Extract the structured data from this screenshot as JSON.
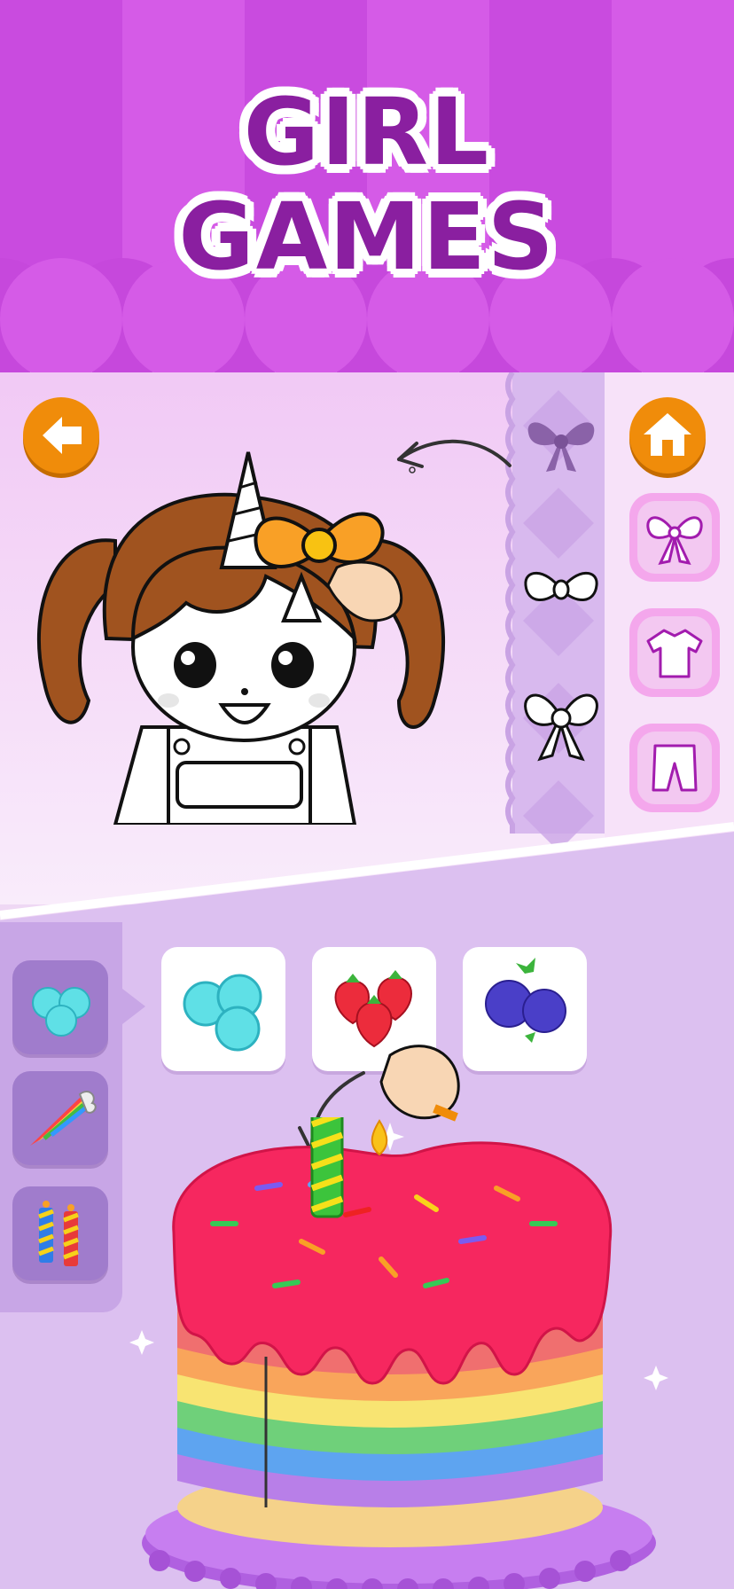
{
  "header": {
    "title_line_1": "GIRL",
    "title_line_2": "GAMES"
  },
  "colors": {
    "awning_light": "#d55be7",
    "awning_dark": "#bd3ed2",
    "title_text": "#8a1fa0",
    "button_orange": "#f08c0a",
    "panel_lavender": "#dcc0f0",
    "bow_purple": "#8a62a8",
    "cake_frosting": "#f6275f"
  },
  "coloring_panel": {
    "back_button_icon": "arrow-left-icon",
    "home_button_icon": "home-icon",
    "accessory_items": [
      "bow-icon-filled",
      "bow-icon-outline",
      "bow-icon-large-outline"
    ],
    "category_buttons": [
      "bow-category-icon",
      "tshirt-category-icon",
      "shorts-category-icon"
    ]
  },
  "cake_panel": {
    "tabs": [
      "candy-balls-icon",
      "sprinkle-cone-icon",
      "candles-icon"
    ],
    "ingredients": [
      "candy-balls-icon",
      "strawberries-icon",
      "blueberries-icon"
    ]
  }
}
